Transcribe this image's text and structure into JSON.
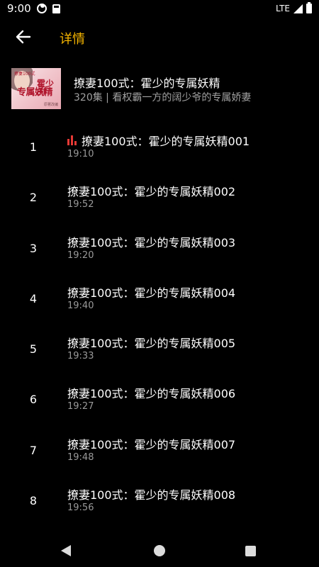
{
  "status_bar": {
    "time": "9:00",
    "network": "LTE",
    "icons": [
      "notification-icon-a",
      "notification-icon-b",
      "signal-icon",
      "battery-icon"
    ]
  },
  "header": {
    "title": "详情",
    "back_icon": "arrow-left-icon",
    "accent_color": "#f4b400"
  },
  "book": {
    "title": "撩妻100式：霍少的专属妖精",
    "meta": "320集 | 看权霸一方的阔少爷的专属娇妻",
    "cover_title": "专属妖精",
    "cover_title_2": "霍少的",
    "cover_top": "撩妻100式",
    "cover_bottom": "原著改编"
  },
  "episodes": [
    {
      "number": "1",
      "title": "撩妻100式：霍少的专属妖精001",
      "time": "19:10",
      "playing": true
    },
    {
      "number": "2",
      "title": "撩妻100式：霍少的专属妖精002",
      "time": "19:52",
      "playing": false
    },
    {
      "number": "3",
      "title": "撩妻100式：霍少的专属妖精003",
      "time": "19:20",
      "playing": false
    },
    {
      "number": "4",
      "title": "撩妻100式：霍少的专属妖精004",
      "time": "19:40",
      "playing": false
    },
    {
      "number": "5",
      "title": "撩妻100式：霍少的专属妖精005",
      "time": "19:33",
      "playing": false
    },
    {
      "number": "6",
      "title": "撩妻100式：霍少的专属妖精006",
      "time": "19:27",
      "playing": false
    },
    {
      "number": "7",
      "title": "撩妻100式：霍少的专属妖精007",
      "time": "19:48",
      "playing": false
    },
    {
      "number": "8",
      "title": "撩妻100式：霍少的专属妖精008",
      "time": "19:56",
      "playing": false
    }
  ],
  "colors": {
    "background": "#000000",
    "playing_indicator": "#e53935",
    "secondary_text": "#a0a0a0"
  },
  "nav_bar": {
    "icons": [
      "nav-back-icon",
      "nav-home-icon",
      "nav-recent-icon"
    ]
  }
}
